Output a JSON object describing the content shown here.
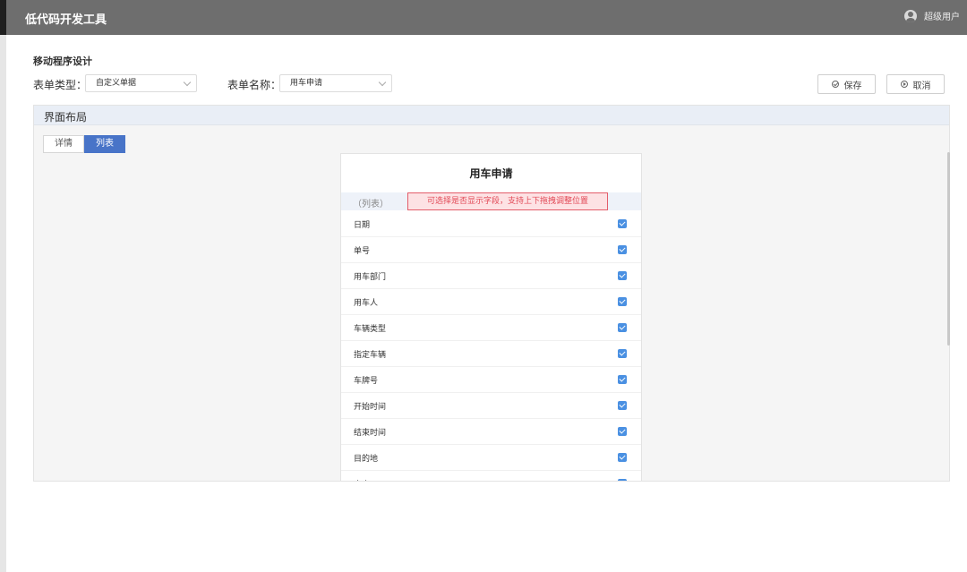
{
  "app": {
    "title": "低代码开发工具",
    "user": "超级用户"
  },
  "page": {
    "heading": "移动程序设计"
  },
  "form": {
    "type_label": "表单类型：",
    "type_value": "自定义单据",
    "name_label": "表单名称：",
    "name_value": "用车申请"
  },
  "actions": {
    "save": "保存",
    "cancel": "取消"
  },
  "layout": {
    "title": "界面布局",
    "tabs": [
      {
        "label": "详情"
      },
      {
        "label": "列表"
      }
    ]
  },
  "preview": {
    "title": "用车申请",
    "list_label": "（列表）",
    "hint": "可选择是否显示字段，支持上下拖拽调整位置",
    "fields": [
      {
        "label": "日期",
        "checked": true
      },
      {
        "label": "单号",
        "checked": true
      },
      {
        "label": "用车部门",
        "checked": true
      },
      {
        "label": "用车人",
        "checked": true
      },
      {
        "label": "车辆类型",
        "checked": true
      },
      {
        "label": "指定车辆",
        "checked": true
      },
      {
        "label": "车牌号",
        "checked": true
      },
      {
        "label": "开始时间",
        "checked": true
      },
      {
        "label": "结束时间",
        "checked": true
      },
      {
        "label": "目的地",
        "checked": true
      },
      {
        "label": "事由",
        "checked": true
      }
    ]
  },
  "colors": {
    "accent": "#4874c8",
    "topbar": "#6e6e6e",
    "hint_border": "#e35d6a",
    "checkbox": "#4a90e2"
  }
}
